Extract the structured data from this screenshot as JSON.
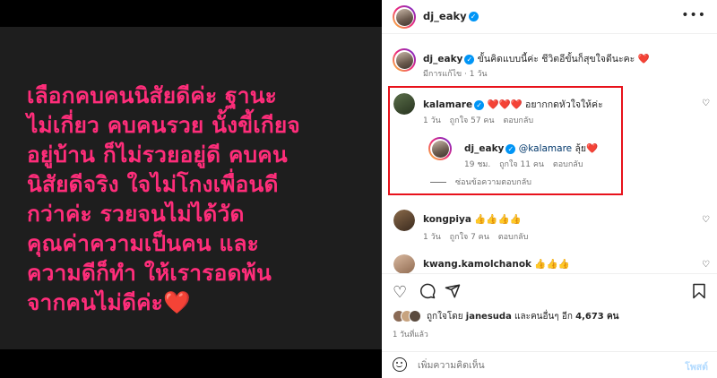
{
  "media": {
    "caption_image_text": "เลือกคบคนนิสัยดีค่ะ ฐานะ\nไม่เกี่ยว คบคนรวย นั้งขี้เกียจ\nอยู่บ้าน ก็ไม่รวยอยู่ดี คบคน\nนิสัยดีจริง ใจไม่โกงเพื่อนดี\nกว่าค่ะ รวยจนไม่ได้วัด\nคุณค่าความเป็นคน และ\nความดีก็ทำ ให้เรารอดพ้น\nจากคนไม่ดีค่ะ❤️",
    "text_color": "#ff2d7a"
  },
  "header": {
    "username": "dj_eaky",
    "more_label": "•••"
  },
  "caption": {
    "username": "dj_eaky",
    "text": "ขั้นคิดแบบนี้ค่ะ ชีวิตอีขั้นก็สุขใจดีนะคะ",
    "emoji": "❤️",
    "meta": "มีการแก้ไข · 1 วัน"
  },
  "comments": [
    {
      "username": "kalamare",
      "hearts": "❤️❤️❤️",
      "text": "อยากกดหัวใจให้ค่ะ",
      "time": "1 วัน",
      "likes": "ถูกใจ 57 คน",
      "reply_label": "ตอบกลับ"
    },
    {
      "username": "dj_eaky",
      "mention": "@kalamare",
      "text": "ลุ้ย",
      "heart": "❤️",
      "time": "19 ชม.",
      "likes": "ถูกใจ 11 คน",
      "reply_label": "ตอบกลับ"
    },
    {
      "username": "kongpiya",
      "text": "👍👍👍👍",
      "time": "1 วัน",
      "likes": "ถูกใจ 7 คน",
      "reply_label": "ตอบกลับ"
    },
    {
      "username": "kwang.kamolchanok",
      "text": "👍👍👍"
    }
  ],
  "hide_replies_label": "ซ่อนข้อความตอบกลับ",
  "likes": {
    "prefix": "ถูกใจโดย",
    "user": "janesuda",
    "suffix": "และคนอื่นๆ อีก",
    "count": "4,673",
    "unit": "คน"
  },
  "post_time": "1 วันที่แล้ว",
  "comment_input": {
    "placeholder": "เพิ่มความคิดเห็น",
    "post_label": "โพสต์"
  },
  "icons": [
    "verified-icon",
    "more-icon",
    "heart-icon",
    "comment-icon",
    "share-icon",
    "save-icon",
    "emoji-icon"
  ],
  "colors": {
    "accent": "#0095f6",
    "highlight": "#e8121b"
  }
}
